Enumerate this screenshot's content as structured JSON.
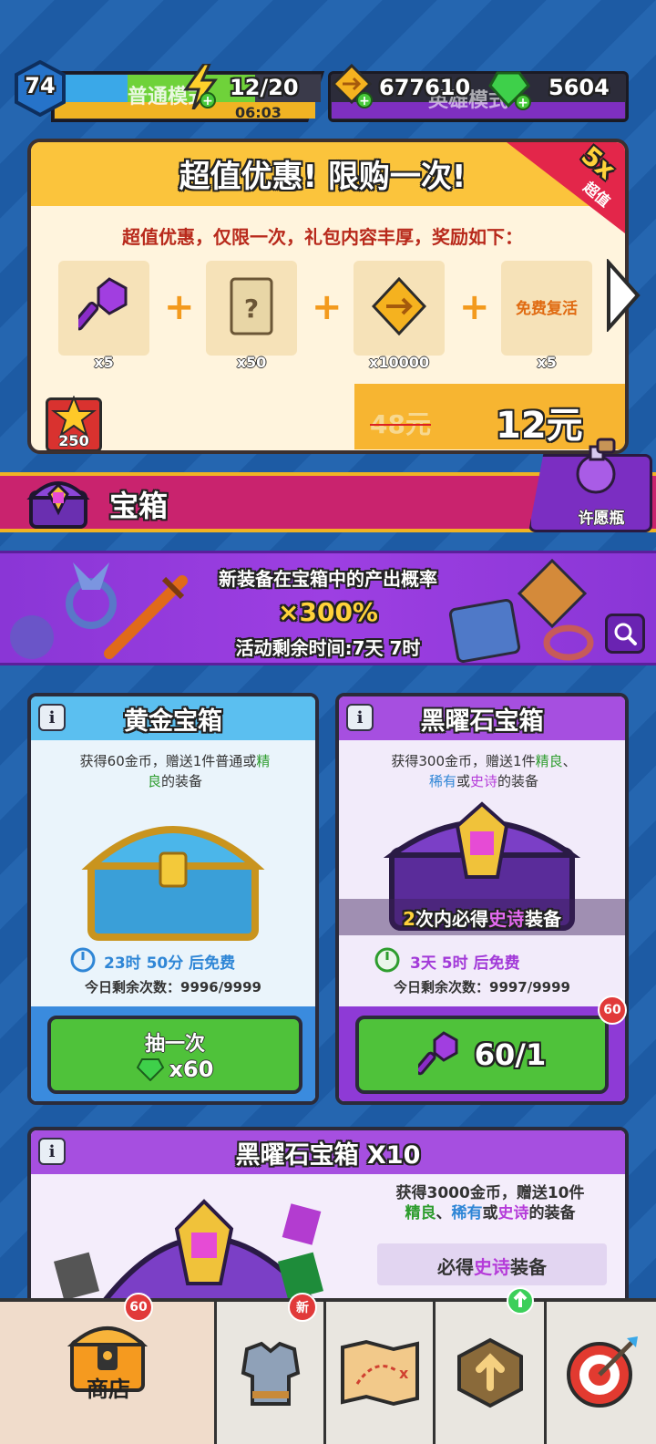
{
  "top": {
    "level": "74",
    "left_label": "普通模式",
    "energy": "12/20",
    "timer": "06:03",
    "coins": "677610",
    "right_label": "英雄模式",
    "gems": "5604"
  },
  "offer": {
    "title": "超值优惠! 限购一次!",
    "ribbon_big": "5x",
    "ribbon_small": "超值",
    "subtitle": "超值优惠，仅限一次，礼包内容丰厚，奖励如下：",
    "items": [
      {
        "icon": "key-icon",
        "qty": "x5"
      },
      {
        "icon": "scroll-icon",
        "qty": "x50"
      },
      {
        "icon": "coin-icon",
        "qty": "x10000"
      },
      {
        "icon": "revive-icon",
        "label": "免费复活",
        "qty": "x5"
      }
    ],
    "old_price": "48元",
    "price": "12元",
    "star_count": "250"
  },
  "section": {
    "title": "宝箱",
    "wish_label": "许愿瓶"
  },
  "banner": {
    "line1": "新装备在宝箱中的产出概率",
    "multiplier": "×300%",
    "line3": "活动剩余时间:7天 7时"
  },
  "gold_chest": {
    "title": "黄金宝箱",
    "desc_a": "获得60金币，赠送1件",
    "desc_b": "普通",
    "desc_c": "或",
    "desc_d": "精",
    "desc_e": "良",
    "desc_f": "的装备",
    "timer": "23时 50分 后免费",
    "remaining": "今日剩余次数：9996/9999",
    "button_label": "抽一次",
    "button_cost": "x60"
  },
  "obsidian_chest": {
    "title": "黑曜石宝箱",
    "desc_a": "获得300金币，赠送1件",
    "desc_b": "精良",
    "desc_c": "、",
    "desc_d": "稀有",
    "desc_e": "或",
    "desc_f": "史诗",
    "desc_g": "的装备",
    "guarantee_num": "2",
    "guarantee_a": "次内必得",
    "guarantee_b": "史诗",
    "guarantee_c": "装备",
    "timer": "3天 5时 后免费",
    "remaining": "今日剩余次数：9997/9999",
    "button_cost": "60/1",
    "badge": "60"
  },
  "obsidian_x10": {
    "title": "黑曜石宝箱 X10",
    "desc_a": "获得3000金币，赠送10件",
    "desc_b": "精良",
    "desc_c": "、",
    "desc_d": "稀有",
    "desc_e": "或",
    "desc_f": "史诗",
    "desc_g": "的装备",
    "guarantee_a": "必得",
    "guarantee_b": "史诗",
    "guarantee_c": "装备"
  },
  "nav": {
    "shop_label": "商店",
    "shop_badge": "60",
    "equip_badge": "新"
  },
  "colors": {
    "accent_gold": "#f0b323",
    "purple": "#8a36d6",
    "green_button": "#4fc23a",
    "red_ribbon": "#e3264a"
  }
}
